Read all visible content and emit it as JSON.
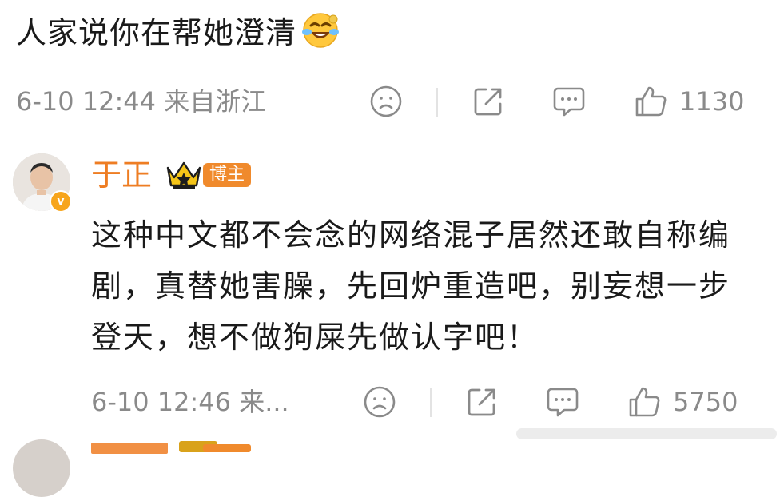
{
  "top_comment": {
    "text": "人家说你在帮她澄清",
    "emoji": "laughing-crying-emoji",
    "meta": {
      "time_location": "6-10 12:44 来自浙江",
      "like_count": "1130"
    }
  },
  "reply": {
    "username": "于正",
    "badge": "博主",
    "text": "这种中文都不会念的网络混子居然还敢自称编剧，真替她害臊，先回炉重造吧，别妄想一步登天，想不做狗屎先做认字吧！",
    "meta": {
      "time_location": "6-10 12:46 来...",
      "like_count": "5750"
    }
  },
  "colors": {
    "username": "#ee7d23",
    "meta_text": "#8a8a8a",
    "badge_bg": "#f08a2c",
    "crown": "#d9a21b"
  },
  "icons": [
    "frown-face-icon",
    "share-icon",
    "comment-icon",
    "thumbs-up-icon",
    "crown-icon",
    "verified-icon"
  ]
}
